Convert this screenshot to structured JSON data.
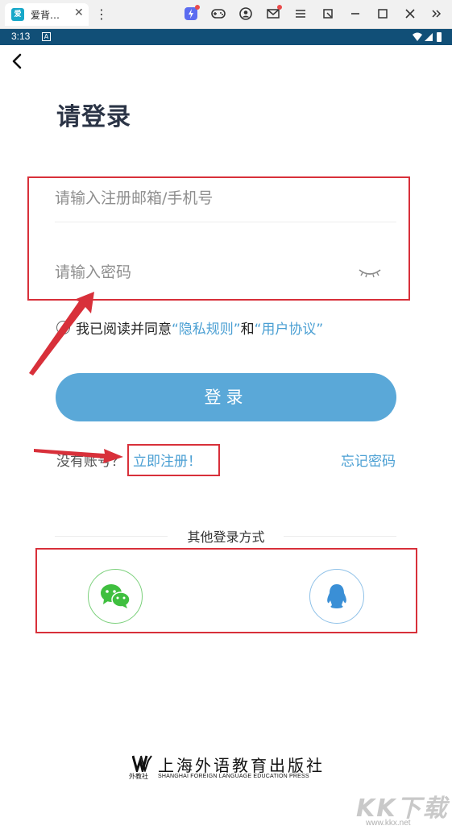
{
  "emulator": {
    "tab_title": "爱背…",
    "tab_icon_text": "爱",
    "tab_close": "✕",
    "menu_glyph": "⋮"
  },
  "status_bar": {
    "time": "3:13",
    "notification_glyph": "A"
  },
  "page": {
    "title": "请登录",
    "account_placeholder": "请输入注册邮箱/手机号",
    "password_placeholder": "请输入密码",
    "agree_prefix": "我已阅读并同意",
    "privacy_link": "“隐私规则”",
    "agree_and": "和",
    "user_agreement_link": "“用户协议”",
    "login_button": "登录",
    "no_account": "没有账号？",
    "register_link": "立即注册！",
    "forgot_password": "忘记密码",
    "other_login": "其他登录方式"
  },
  "footer": {
    "logo_sub": "外教社",
    "publisher_name": "上海外语教育出版社",
    "publisher_en": "SHANGHAI FOREIGN LANGUAGE EDUCATION PRESS"
  },
  "watermark": {
    "big": "KK下载",
    "url": "www.kkx.net"
  },
  "colors": {
    "accent_blue": "#5aa8d8",
    "link_blue": "#4a9fd3",
    "status_bar": "#114f77",
    "annotation_red": "#d8303a",
    "wechat_green": "#3fbf3f",
    "qq_blue": "#3a8fd6"
  },
  "icons": {
    "back": "chevron-left-icon",
    "eye": "eye-closed-icon",
    "wechat": "wechat-icon",
    "qq": "qq-icon"
  }
}
